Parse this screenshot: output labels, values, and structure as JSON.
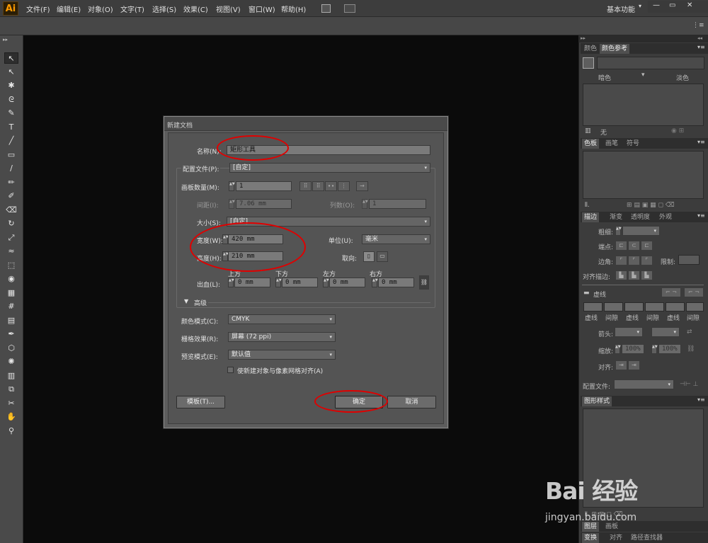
{
  "app": {
    "logo": "Ai",
    "workspace": "基本功能"
  },
  "menu": [
    "文件(F)",
    "编辑(E)",
    "对象(O)",
    "文字(T)",
    "选择(S)",
    "效果(C)",
    "视图(V)",
    "窗口(W)",
    "帮助(H)"
  ],
  "window_controls": {
    "minimize": "—",
    "restore": "▭",
    "close": "✕"
  },
  "toolbar_collapse": "▸▸",
  "tools": [
    "selection-tool-icon",
    "direct-selection-tool-icon",
    "magic-wand-tool-icon",
    "lasso-tool-icon",
    "pen-tool-icon",
    "type-tool-icon",
    "line-tool-icon",
    "rectangle-tool-icon",
    "paintbrush-tool-icon",
    "pencil-tool-icon",
    "blob-brush-tool-icon",
    "eraser-tool-icon",
    "rotate-tool-icon",
    "scale-tool-icon",
    "warp-tool-icon",
    "free-transform-tool-icon",
    "shape-builder-tool-icon",
    "perspective-grid-tool-icon",
    "mesh-tool-icon",
    "gradient-tool-icon",
    "eyedropper-tool-icon",
    "blend-tool-icon",
    "symbol-sprayer-tool-icon",
    "column-graph-tool-icon",
    "artboard-tool-icon",
    "slice-tool-icon",
    "hand-tool-icon",
    "zoom-tool-icon"
  ],
  "tool_glyphs": [
    "↖",
    "↖",
    "✱",
    "ᘓ",
    "✎",
    "T",
    "╱",
    "▭",
    "∕",
    "✏",
    "✐",
    "⌫",
    "↻",
    "⤢",
    "≈",
    "⬚",
    "◉",
    "▦",
    "#",
    "▤",
    "✒",
    "⬡",
    "✺",
    "▥",
    "⧉",
    "✂",
    "✋",
    "⚲"
  ],
  "dialog": {
    "title": "新建文档",
    "name_label": "名称(N):",
    "name_value": "矩形工具",
    "profile_label": "配置文件(P):",
    "profile_value": "[自定]",
    "artboards_label": "画板数量(M):",
    "artboards_value": "1",
    "spacing_label": "间距(I):",
    "spacing_value": "7.06 mm",
    "columns_label": "列数(O):",
    "columns_value": "1",
    "size_label": "大小(S):",
    "size_value": "[自定]",
    "width_label": "宽度(W):",
    "width_value": "420 mm",
    "units_label": "单位(U):",
    "units_value": "毫米",
    "height_label": "高度(H):",
    "height_value": "210 mm",
    "orientation_label": "取向:",
    "bleed_label": "出血(L):",
    "bleed_top_label": "上方",
    "bleed_bottom_label": "下方",
    "bleed_left_label": "左方",
    "bleed_right_label": "右方",
    "bleed_top": "0 mm",
    "bleed_bottom": "0 mm",
    "bleed_left": "0 mm",
    "bleed_right": "0 mm",
    "advanced_label": "高级",
    "color_mode_label": "颜色模式(C):",
    "color_mode_value": "CMYK",
    "raster_label": "栅格效果(R):",
    "raster_value": "屏幕 (72 ppi)",
    "preview_label": "预览模式(E):",
    "preview_value": "默认值",
    "align_checkbox_label": "使新建对象与像素网格对齐(A)",
    "templates_button": "模板(T)...",
    "ok_button": "确定",
    "cancel_button": "取消"
  },
  "panels": {
    "color_tabs": [
      "颜色",
      "颜色参考"
    ],
    "color_dark": "暗色",
    "color_light": "淡色",
    "color_none": "无",
    "swatch_tabs": [
      "色板",
      "画笔",
      "符号"
    ],
    "stroke_tabs": [
      "描边",
      "渐变",
      "透明度",
      "外观"
    ],
    "weight_label": "粗细:",
    "cap_label": "端点:",
    "corner_label": "边角:",
    "limit_label": "限制:",
    "align_stroke_label": "对齐描边:",
    "dashed_label": "虚线",
    "dash_labels": [
      "虚线",
      "间隙",
      "虚线",
      "间隙",
      "虚线",
      "间隙"
    ],
    "arrow_label": "箭头:",
    "scale_label": "缩放:",
    "scale_start": "100%",
    "scale_end": "100%",
    "align_label": "对齐:",
    "profile_label": "配置文件:",
    "graphic_styles_tab": "图形样式",
    "bottom_tabs_1": [
      "图层",
      "画板"
    ],
    "bottom_tabs_2": [
      "变换",
      "对齐",
      "路径查找器"
    ]
  },
  "watermark": {
    "brand": "Bai 经验",
    "url": "jingyan.baidu.com"
  },
  "colors": {
    "accent_red": "#e00000",
    "logo_orange": "#ff9a00"
  }
}
